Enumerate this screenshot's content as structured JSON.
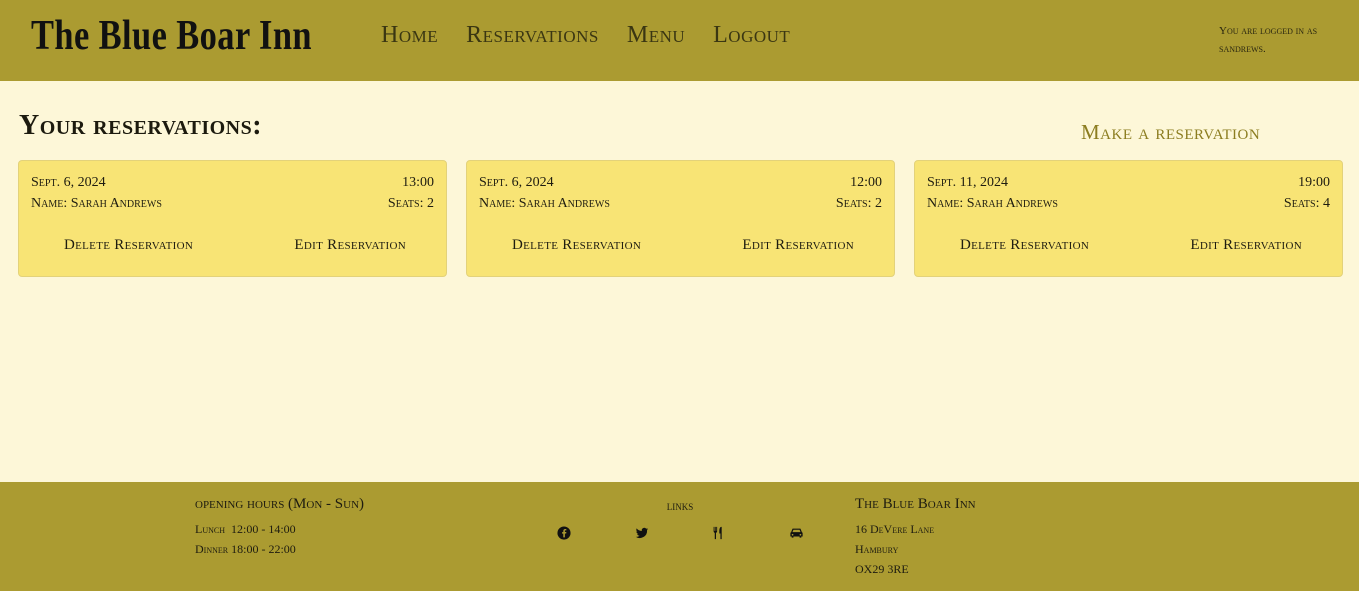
{
  "header": {
    "brand": "The Blue Boar Inn",
    "nav": [
      "Home",
      "Reservations",
      "Menu",
      "Logout"
    ],
    "logged_in_text": "You are logged in as sandrews."
  },
  "main": {
    "title": "Your reservations:",
    "make_reservation": "Make a reservation",
    "reservations": [
      {
        "date": "Sept. 6, 2024",
        "time": "13:00",
        "name": "Name: Sarah Andrews",
        "seats": "Seats: 2",
        "delete": "Delete Reservation",
        "edit": "Edit Reservation"
      },
      {
        "date": "Sept. 6, 2024",
        "time": "12:00",
        "name": "Name: Sarah Andrews",
        "seats": "Seats: 2",
        "delete": "Delete Reservation",
        "edit": "Edit Reservation"
      },
      {
        "date": "Sept. 11, 2024",
        "time": "19:00",
        "name": "Name: Sarah Andrews",
        "seats": "Seats: 4",
        "delete": "Delete Reservation",
        "edit": "Edit Reservation"
      }
    ]
  },
  "footer": {
    "hours_heading": "opening hours (Mon - Sun)",
    "lunch": "Lunch  12:00 - 14:00",
    "dinner": "Dinner 18:00 - 22:00",
    "links_heading": "links",
    "link_icons": [
      "facebook-icon",
      "twitter-icon",
      "utensils-icon",
      "car-icon"
    ],
    "address_heading": "The Blue Boar Inn",
    "address_line1": "16 DeVere Lane",
    "address_line2": "Hambury",
    "address_line3": "OX29 3RE"
  },
  "colors": {
    "header_bg": "#ab9b31",
    "page_bg": "#fdf7d8",
    "card_bg": "#f8e475",
    "accent": "#8c7d20"
  }
}
